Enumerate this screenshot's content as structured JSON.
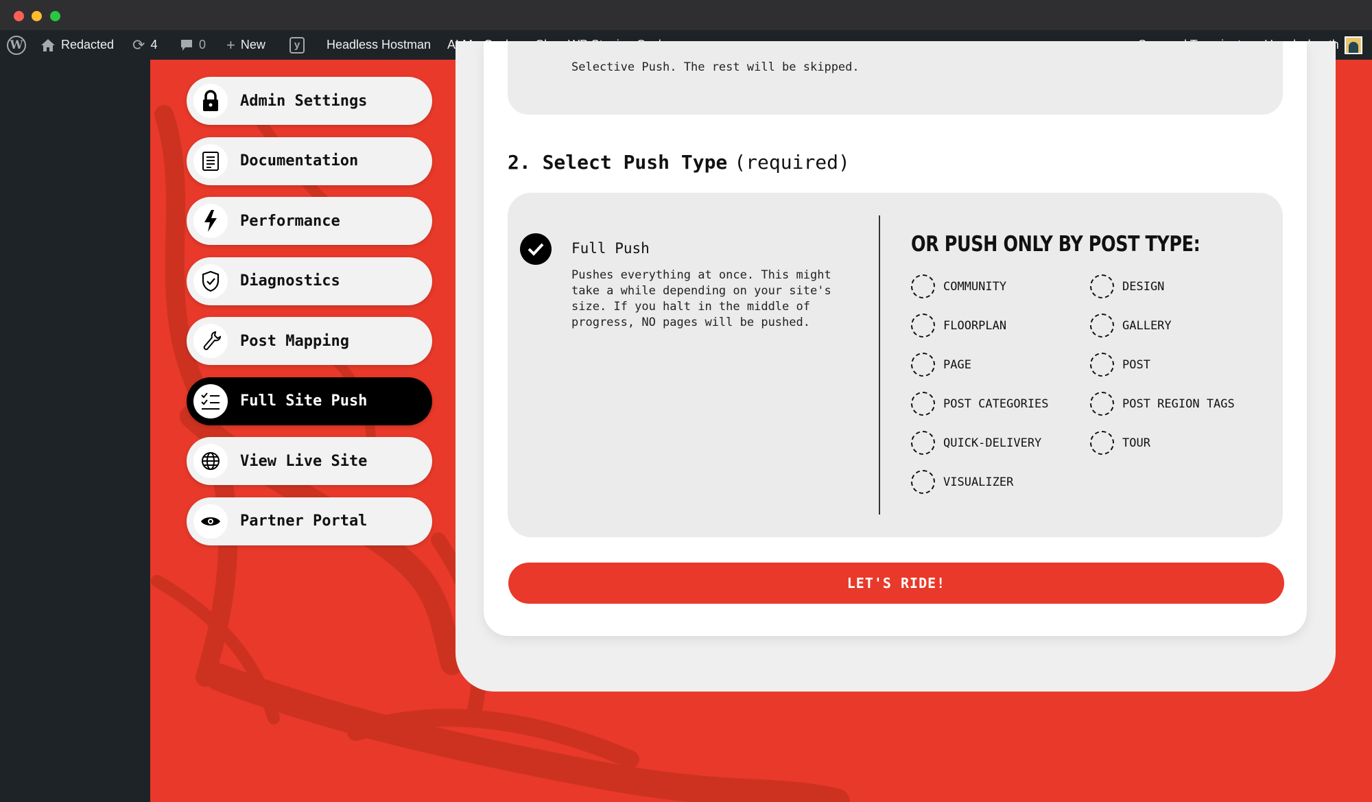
{
  "window": {
    "controls": [
      "close",
      "minimize",
      "zoom"
    ]
  },
  "adminbar": {
    "site_name": "Redacted",
    "updates_count": "4",
    "comments_count": "0",
    "new_label": "New",
    "headless_hostman": "Headless Hostman",
    "alm_cache": "ALM - Cache",
    "clear_staging": "Clear WP Staging Cache",
    "suspend_transients": "Suspend Transients",
    "howdy": "Howdy, benth"
  },
  "nav": {
    "items": [
      {
        "label": "Admin Settings",
        "icon": "lock-icon",
        "active": false
      },
      {
        "label": "Documentation",
        "icon": "document-icon",
        "active": false
      },
      {
        "label": "Performance",
        "icon": "lightning-icon",
        "active": false
      },
      {
        "label": "Diagnostics",
        "icon": "shield-check-icon",
        "active": false
      },
      {
        "label": "Post Mapping",
        "icon": "wrench-icon",
        "active": false
      },
      {
        "label": "Full Site Push",
        "icon": "checklist-icon",
        "active": true
      },
      {
        "label": "View Live Site",
        "icon": "globe-icon",
        "active": false
      },
      {
        "label": "Partner Portal",
        "icon": "eye-icon",
        "active": false
      }
    ]
  },
  "main": {
    "prev_text": "Selective Push. The rest will be skipped.",
    "section_number_title": "2. Select Push Type",
    "section_required": "(required)",
    "full_push": {
      "title": "Full Push",
      "selected": true,
      "description": "Pushes everything at once. This might take a while depending on your site's size. If you halt in the middle of progress, NO pages will be pushed."
    },
    "post_type_heading": "OR PUSH ONLY BY POST TYPE:",
    "post_types": [
      "COMMUNITY",
      "DESIGN",
      "FLOORPLAN",
      "GALLERY",
      "PAGE",
      "POST",
      "POST CATEGORIES",
      "POST REGION TAGS",
      "QUICK-DELIVERY",
      "TOUR",
      "VISUALIZER"
    ],
    "submit_label": "LET'S RIDE!"
  },
  "colors": {
    "accent_red": "#e8392a",
    "admin_bar": "#1d2327",
    "panel_bg": "#efefef",
    "option_bg": "#ebebeb"
  }
}
